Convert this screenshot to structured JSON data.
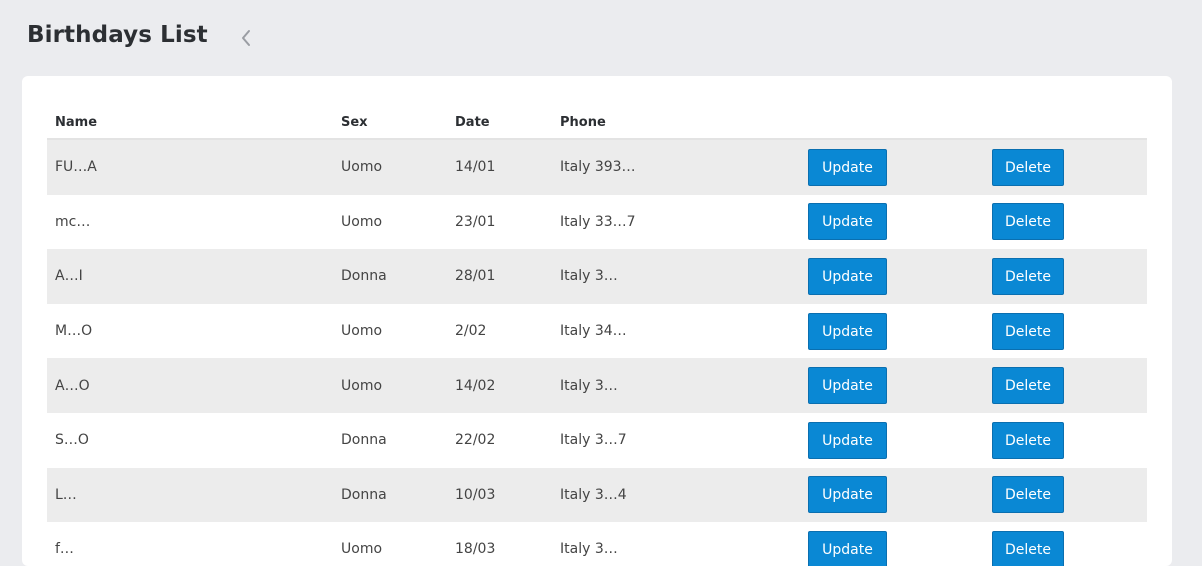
{
  "header": {
    "title": "Birthdays List",
    "back_icon": "chevron-left-icon"
  },
  "table": {
    "columns": [
      "Name",
      "Sex",
      "Date",
      "Phone"
    ],
    "update_label": "Update",
    "delete_label": "Delete",
    "rows": [
      {
        "name": "FU…A",
        "sex": "Uomo",
        "date": "14/01",
        "phone": "Italy 393…"
      },
      {
        "name": "mc…",
        "sex": "Uomo",
        "date": "23/01",
        "phone": "Italy 33…7"
      },
      {
        "name": "A…I",
        "sex": "Donna",
        "date": "28/01",
        "phone": "Italy 3…"
      },
      {
        "name": "M…O",
        "sex": "Uomo",
        "date": "2/02",
        "phone": "Italy 34…"
      },
      {
        "name": "A…O",
        "sex": "Uomo",
        "date": "14/02",
        "phone": "Italy 3…"
      },
      {
        "name": "S…O",
        "sex": "Donna",
        "date": "22/02",
        "phone": "Italy 3…7"
      },
      {
        "name": "L…",
        "sex": "Donna",
        "date": "10/03",
        "phone": "Italy 3…4"
      },
      {
        "name": "f…",
        "sex": "Uomo",
        "date": "18/03",
        "phone": "Italy 3…"
      }
    ]
  },
  "colors": {
    "accent": "#0a88d4",
    "background": "#ebecef",
    "stripe": "#ececec"
  }
}
